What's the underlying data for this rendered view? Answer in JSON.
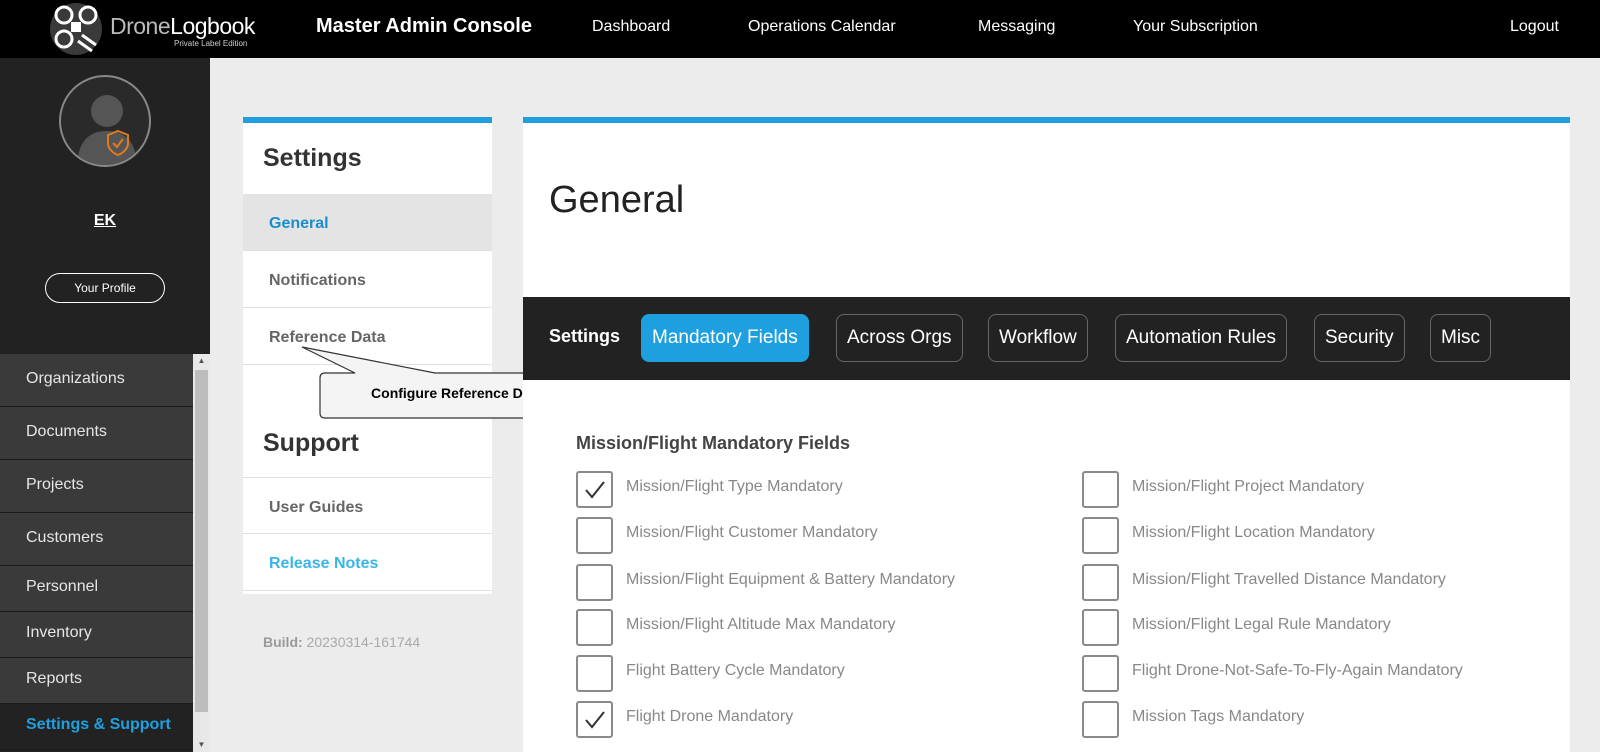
{
  "brand": {
    "name_part1": "Drone",
    "name_part2": "Logbook",
    "subtitle": "Private Label Edition"
  },
  "header": {
    "title": "Master Admin Console",
    "nav": [
      "Dashboard",
      "Operations Calendar",
      "Messaging",
      "Your Subscription"
    ],
    "logout": "Logout"
  },
  "sidebar": {
    "user_initials": "EK",
    "profile_button": "Your Profile",
    "items": [
      {
        "label": "Organizations"
      },
      {
        "label": "Documents"
      },
      {
        "label": "Projects"
      },
      {
        "label": "Customers"
      },
      {
        "label": "Personnel"
      },
      {
        "label": "Inventory"
      },
      {
        "label": "Reports"
      },
      {
        "label": "Settings & Support"
      }
    ],
    "active_item": "Settings & Support"
  },
  "settings_panel": {
    "heading": "Settings",
    "items": [
      "General",
      "Notifications",
      "Reference Data"
    ],
    "selected": "General",
    "support_heading": "Support",
    "support_items": [
      "User Guides",
      "Release Notes"
    ],
    "build_label": "Build:",
    "build_value": "20230314-161744"
  },
  "tooltip": {
    "text": "Configure Reference Data"
  },
  "main": {
    "title": "General",
    "tabs_label": "Settings",
    "tabs": [
      "Mandatory Fields",
      "Across Orgs",
      "Workflow",
      "Automation Rules",
      "Security",
      "Misc"
    ],
    "active_tab": "Mandatory Fields",
    "section_title": "Mission/Flight Mandatory Fields",
    "fields_left": [
      {
        "label": "Mission/Flight Type Mandatory",
        "checked": true
      },
      {
        "label": "Mission/Flight Customer Mandatory",
        "checked": false
      },
      {
        "label": "Mission/Flight Equipment & Battery Mandatory",
        "checked": false
      },
      {
        "label": "Mission/Flight Altitude Max Mandatory",
        "checked": false
      },
      {
        "label": "Flight Battery Cycle Mandatory",
        "checked": false
      },
      {
        "label": "Flight Drone Mandatory",
        "checked": true
      }
    ],
    "fields_right": [
      {
        "label": "Mission/Flight Project Mandatory",
        "checked": false
      },
      {
        "label": "Mission/Flight Location Mandatory",
        "checked": false
      },
      {
        "label": "Mission/Flight Travelled Distance Mandatory",
        "checked": false
      },
      {
        "label": "Mission/Flight Legal Rule Mandatory",
        "checked": false
      },
      {
        "label": "Flight Drone-Not-Safe-To-Fly-Again Mandatory",
        "checked": false
      },
      {
        "label": "Mission Tags Mandatory",
        "checked": false
      }
    ]
  },
  "colors": {
    "accent": "#1ea0e0",
    "topbar": "#000000",
    "sidebar": "#222222"
  }
}
